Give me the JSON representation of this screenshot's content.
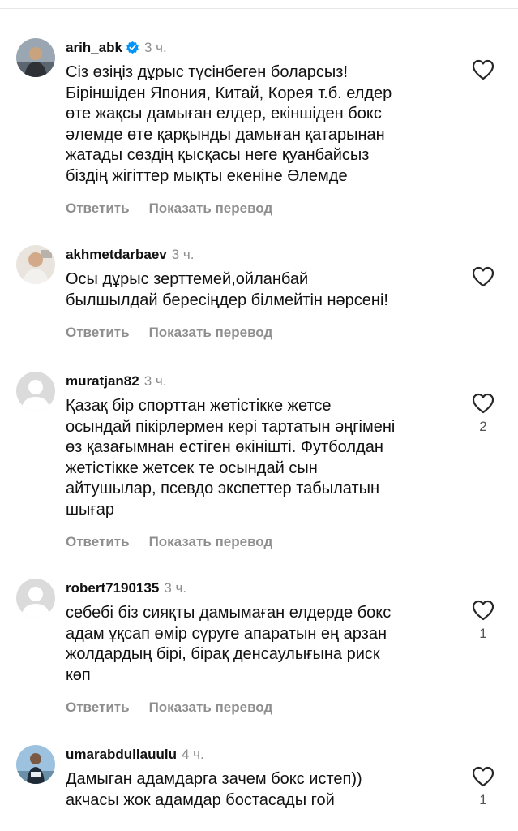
{
  "comments": [
    {
      "username": "arih_abk",
      "verified": true,
      "time": "3 ч.",
      "text": "Сіз өзіңіз дұрыс түсінбеген боларсыз!\nБіріншіден Япония, Китай,  Корея т.б. елдер\nөте жақсы дамыған елдер,  екіншіден бокс\nәлемде өте қарқынды дамыған қатарынан\nжатады сөздің қысқасы неге қуанбайсыз\nбіздің жігіттер мықты екеніне Әлемде",
      "reply": "Ответить",
      "translate": "Показать перевод",
      "likes": "",
      "avatar": "photo"
    },
    {
      "username": "akhmetdarbaev",
      "verified": false,
      "time": "3 ч.",
      "text": "Осы  дұрыс зерттемей,ойланбай\nбылшылдай бересіңдер білмейтін нәрсені!",
      "reply": "Ответить",
      "translate": "Показать перевод",
      "likes": "",
      "avatar": "photo"
    },
    {
      "username": "muratjan82",
      "verified": false,
      "time": "3 ч.",
      "text": "Қазақ бір спорттан жетістікке жетсе\nосындай пікірлермен кері тартатын әңгімені\nөз қазағымнан естіген өкінішті. Футболдан\nжетістікке жетсек те осындай сын\nайтушылар, псевдо экспеттер табылатын\nшығар",
      "reply": "Ответить",
      "translate": "Показать перевод",
      "likes": "2",
      "avatar": "default"
    },
    {
      "username": "robert7190135",
      "verified": false,
      "time": "3 ч.",
      "text": "себебі біз сияқты дамымаған елдерде бокс\nадам ұқсап өмір сүруге апаратын ең арзан\nжолдардың бірі, бірақ денсаулығына риск\nкөп",
      "reply": "Ответить",
      "translate": "Показать перевод",
      "likes": "1",
      "avatar": "default"
    },
    {
      "username": "umarabdullauulu",
      "verified": false,
      "time": "4 ч.",
      "text": "Дамыган адамдарга зачем бокс истеп))\nакчасы жок адамдар бостасады гой",
      "reply": "",
      "translate": "",
      "likes": "1",
      "avatar": "photo"
    }
  ],
  "icons": {
    "like": "heart-outline-icon",
    "verified": "verified-badge-icon"
  },
  "colors": {
    "text": "#111111",
    "muted": "#8e8e8e",
    "verified": "#0095f6"
  }
}
